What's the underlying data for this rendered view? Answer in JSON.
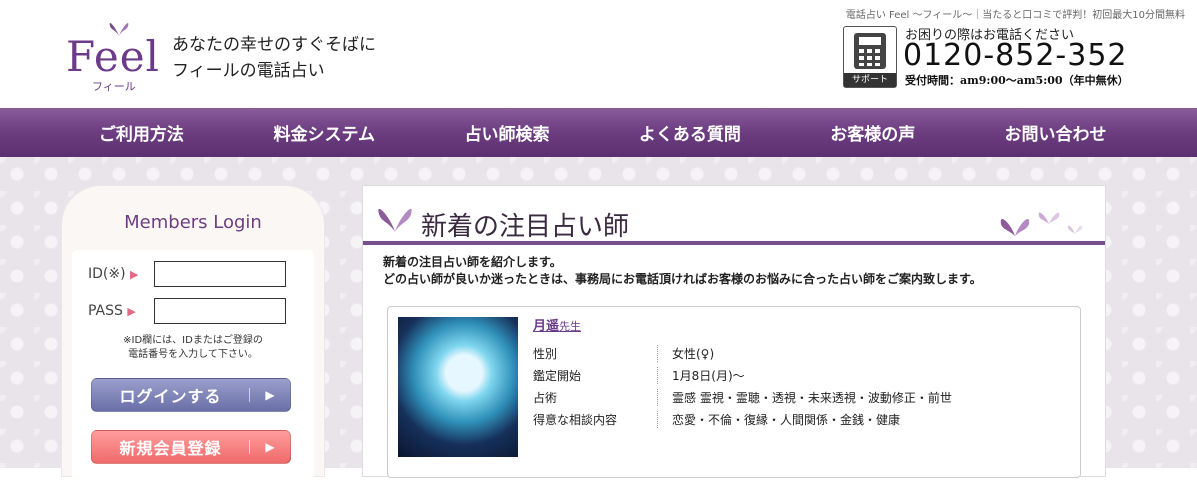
{
  "header": {
    "logo_text": "Feel",
    "logo_sub": "フィール",
    "tagline_line1": "あなたの幸せのすぐそばに",
    "tagline_line2": "フィールの電話占い",
    "top_note": "電話占い Feel ～フィール～｜当たると口コミで評判！初回最大10分間無料",
    "phone_label": "サポート",
    "help_text": "お困りの際はお電話ください",
    "phone_number": "0120-852-352",
    "hours": "受付時間：am9:00～am5:00（年中無休）"
  },
  "nav": {
    "items": [
      "ご利用方法",
      "料金システム",
      "占い師検索",
      "よくある質問",
      "お客様の声",
      "お問い合わせ"
    ]
  },
  "login": {
    "title": "Members Login",
    "id_label": "ID(※)",
    "pass_label": "PASS",
    "arrow": "▶",
    "id_value": "",
    "pass_value": "",
    "note_line1": "※ID欄には、IDまたはご登録の",
    "note_line2": "電話番号を入力して下さい。",
    "login_button": "ログインする",
    "register_button": "新規会員登録",
    "chevron": "▶"
  },
  "main": {
    "section_title": "新着の注目占い師",
    "intro_line1": "新着の注目占い師を紹介します。",
    "intro_line2": "どの占い師が良いか迷ったときは、事務局にお電話頂ければお客様のお悩みに合った占い師をご案内致します。",
    "card": {
      "name": "月遥",
      "name_suffix": "先生",
      "rows": [
        {
          "key": "性別",
          "value": "女性(♀)"
        },
        {
          "key": "鑑定開始",
          "value": "1月8日(月)～"
        },
        {
          "key": "占術",
          "value": "霊感 霊視・霊聴・透視・未来透視・波動修正・前世"
        },
        {
          "key": "得意な相談内容",
          "value": "恋愛・不倫・復縁・人間関係・金銭・健康"
        }
      ]
    }
  },
  "colors": {
    "brand_purple": "#6b3a8a",
    "nav_purple": "#6e3f82",
    "login_button": "#7a7fb8",
    "register_button": "#f27878"
  }
}
